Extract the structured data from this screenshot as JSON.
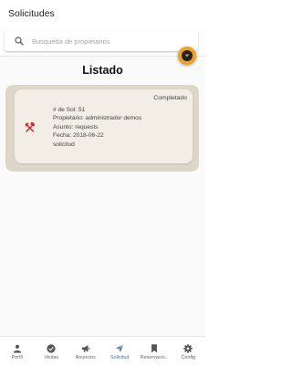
{
  "appbar": {
    "title": "Solicitudes"
  },
  "search": {
    "placeholder": "Busqueda de propietarios"
  },
  "main": {
    "heading": "Listado"
  },
  "card": {
    "status": "Completado",
    "lines": [
      "# de Sol: 51",
      "Propietario: administrador demos",
      "Asunto: requests",
      "Fecha: 2018-06-22",
      "solicitud"
    ]
  },
  "bottom_nav": {
    "items": [
      {
        "label": "Perfil",
        "icon": "person-icon"
      },
      {
        "label": "Visitas",
        "icon": "check-circle-icon"
      },
      {
        "label": "Anuncios",
        "icon": "megaphone-icon"
      },
      {
        "label": "Solicitud",
        "icon": "send-icon"
      },
      {
        "label": "Reservacio...",
        "icon": "bookmark-icon"
      },
      {
        "label": "Config",
        "icon": "gear-icon"
      }
    ],
    "active_index": 3
  },
  "colors": {
    "accent": "#f0a02a",
    "active_nav": "#3b6fb6",
    "card_outer": "#ded7c9",
    "card_inner": "#f2ede5",
    "tool_icon": "#d62828"
  }
}
